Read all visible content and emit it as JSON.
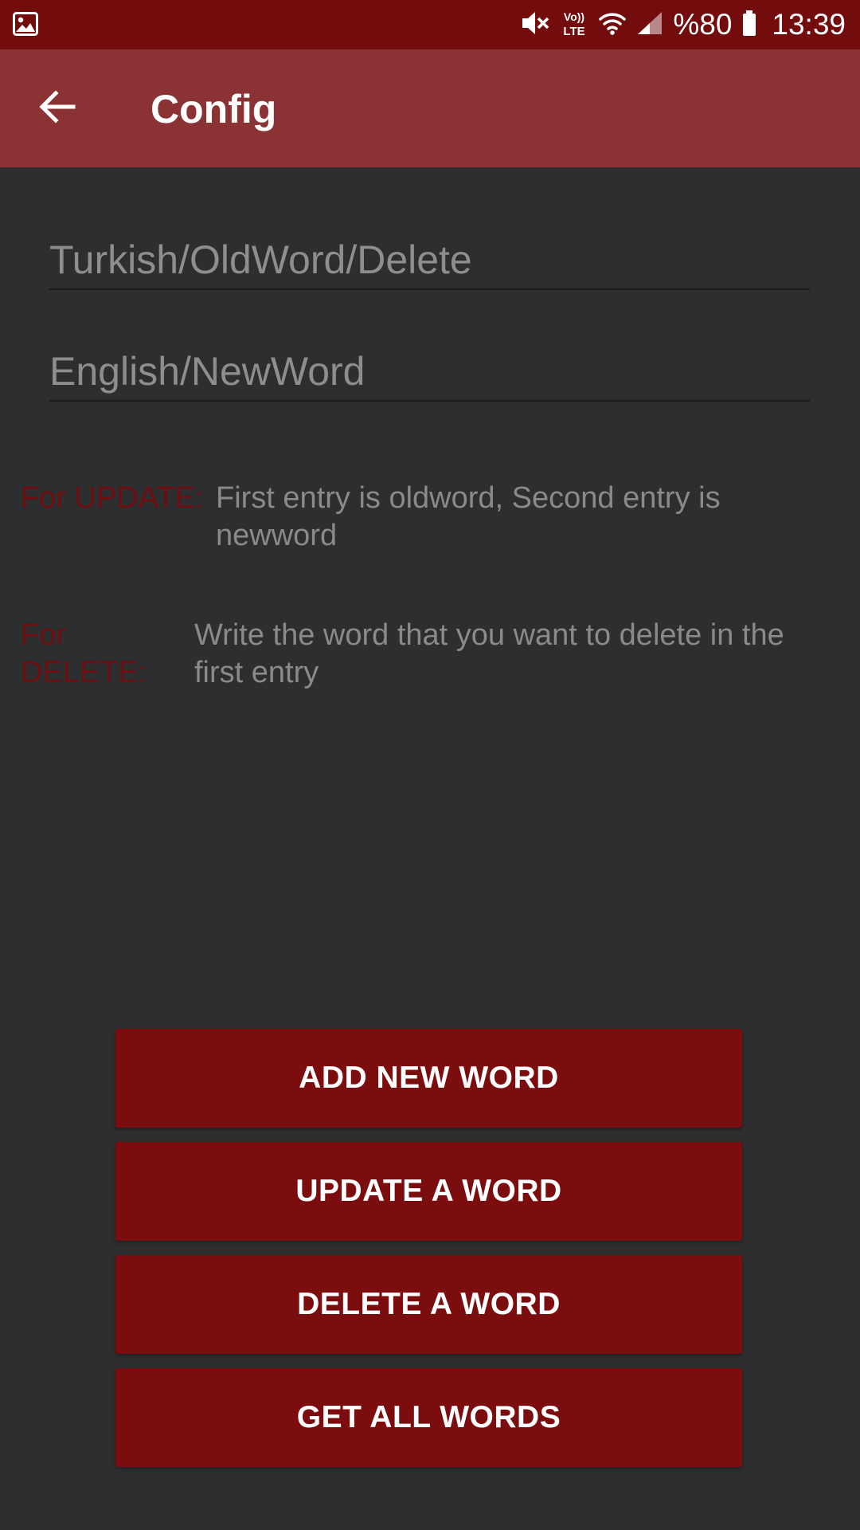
{
  "status_bar": {
    "icons": [
      "gallery-icon",
      "mute-icon",
      "volte-icon",
      "wifi-icon",
      "signal-icon",
      "battery-icon"
    ],
    "volte_line1": "Vo))",
    "volte_line2": "LTE",
    "battery": "%80",
    "time": "13:39"
  },
  "app_bar": {
    "title": "Config",
    "back_icon": "arrow-left-icon"
  },
  "fields": {
    "first_placeholder": "Turkish/OldWord/Delete",
    "first_value": "",
    "second_placeholder": "English/NewWord",
    "second_value": ""
  },
  "notes": {
    "update_label": "For UPDATE:",
    "update_text": "First entry is oldword, Second entry is newword",
    "delete_label": "For DELETE:",
    "delete_text": "Write the word that you want to delete in the first entry"
  },
  "buttons": {
    "add": "ADD NEW WORD",
    "update": "UPDATE A WORD",
    "delete": "DELETE A WORD",
    "get_all": "GET ALL WORDS"
  },
  "colors": {
    "status_bar": "#720c0d",
    "app_bar": "#8b3334",
    "background": "#2d2e30",
    "button": "#7b0d0e",
    "label_accent": "#6e0e10",
    "hint_text": "#8e8e8e"
  }
}
